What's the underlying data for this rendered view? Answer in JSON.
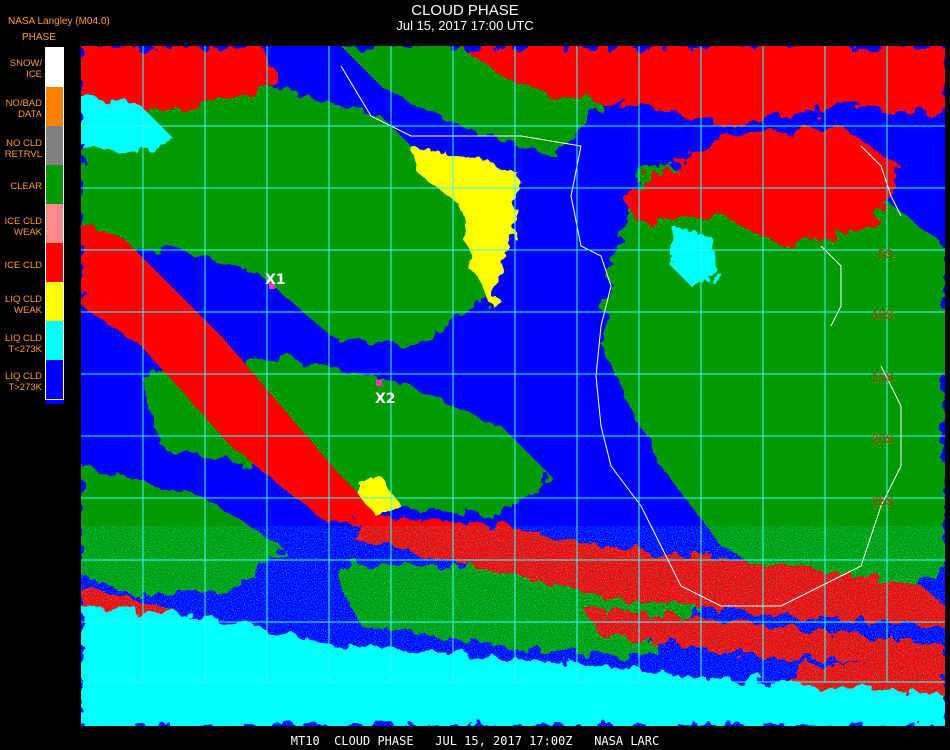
{
  "header": {
    "title": "CLOUD PHASE",
    "subtitle": "Jul 15, 2017 17:00 UTC",
    "org_label": "NASA Langley (M04.0)"
  },
  "legend": {
    "header": "PHASE",
    "items": [
      {
        "label": "SNOW/\nICE",
        "color": "#ffffff"
      },
      {
        "label": "NO/BAD\nDATA",
        "color": "#ff7f00"
      },
      {
        "label": "NO CLD\nRETRVL",
        "color": "#808080"
      },
      {
        "label": "CLEAR",
        "color": "#009900"
      },
      {
        "label": "ICE CLD\nWEAK",
        "color": "#ff8888"
      },
      {
        "label": "ICE CLD",
        "color": "#ff0000"
      },
      {
        "label": "LIQ CLD\nWEAK",
        "color": "#ffff00"
      },
      {
        "label": "LIQ CLD\nT<273K",
        "color": "#00ffff"
      },
      {
        "label": "LIQ CLD\nT>273K",
        "color": "#0000ff"
      }
    ]
  },
  "map": {
    "latitude_labels": [
      "5S",
      "10S",
      "15S",
      "20S",
      "25S"
    ],
    "markers": [
      {
        "label": "X1",
        "color": "#ff33cc"
      },
      {
        "label": "X2",
        "color": "#ff33cc"
      }
    ],
    "grid_color": "#33ffff",
    "coast_color": "#ffffff",
    "label_color": "#cc3300"
  },
  "footer": {
    "caption": "MT10  CLOUD PHASE   JUL 15, 2017 17:00Z   NASA LARC"
  }
}
